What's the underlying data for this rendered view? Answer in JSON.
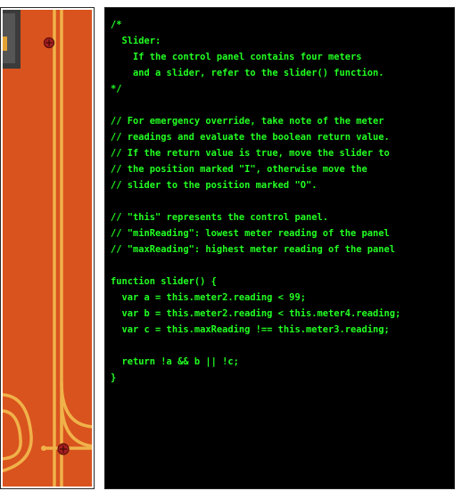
{
  "code": {
    "lines": [
      "/*",
      "  Slider:",
      "    If the control panel contains four meters",
      "    and a slider, refer to the slider() function.",
      "*/",
      "",
      "// For emergency override, take note of the meter",
      "// readings and evaluate the boolean return value.",
      "// If the return value is true, move the slider to",
      "// the position marked \"I\", otherwise move the",
      "// slider to the position marked \"O\".",
      "",
      "// \"this\" represents the control panel.",
      "// \"minReading\": lowest meter reading of the panel",
      "// \"maxReading\": highest meter reading of the panel",
      "",
      "function slider() {",
      "  var a = this.meter2.reading < 99;",
      "  var b = this.meter2.reading < this.meter4.reading;",
      "  var c = this.maxReading !== this.meter3.reading;",
      "",
      "  return !a && b || !c;",
      "}"
    ]
  },
  "colors": {
    "code_text": "#22ff22",
    "code_background": "#000000",
    "panel_orange": "#d9531e",
    "wire_yellow": "#f0b24a",
    "screw_red": "#8a1a1a"
  }
}
